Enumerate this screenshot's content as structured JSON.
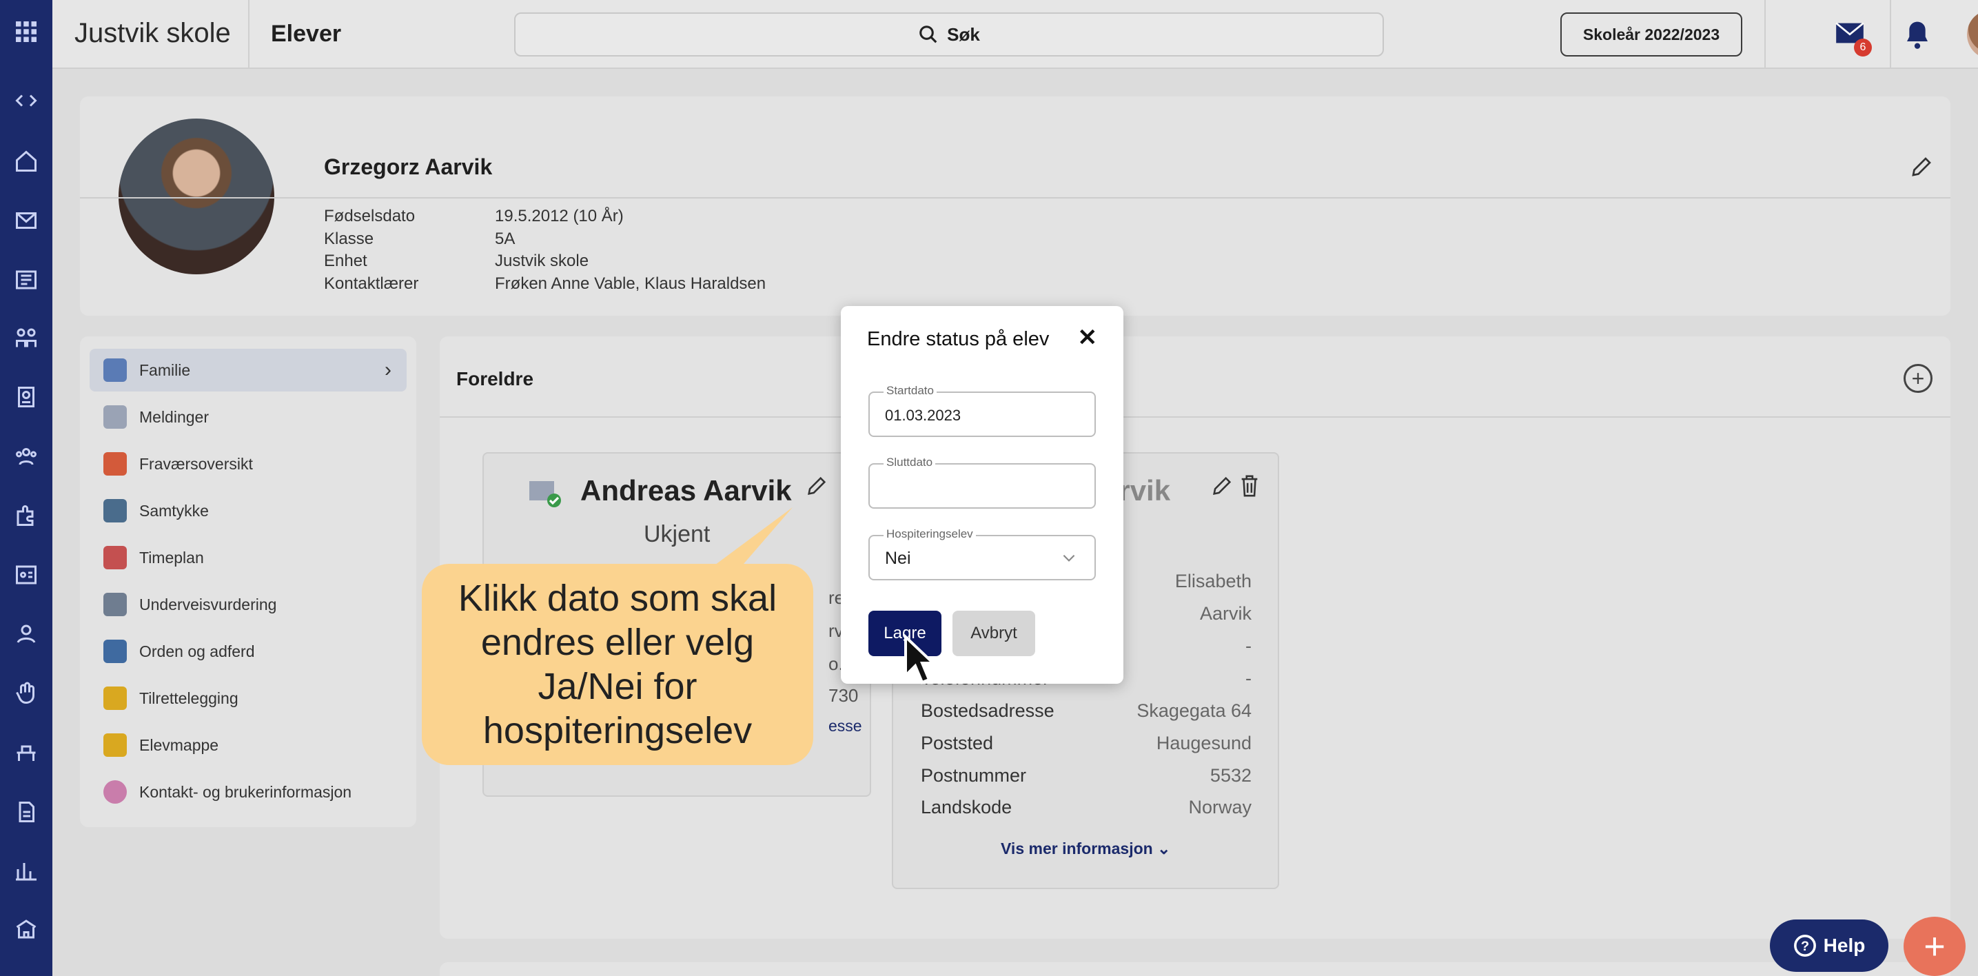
{
  "topbar": {
    "school_name": "Justvik skole",
    "section": "Elever",
    "search_label": "Søk",
    "school_year_button": "Skoleår 2022/2023",
    "mail_badge": "6"
  },
  "profile": {
    "name": "Grzegorz Aarvik",
    "fields": [
      {
        "label": "Fødselsdato",
        "value": "19.5.2012 (10 År)"
      },
      {
        "label": "Klasse",
        "value": "5A"
      },
      {
        "label": "Enhet",
        "value": "Justvik skole"
      },
      {
        "label": "Kontaktlærer",
        "value": "Frøken Anne Vable, Klaus Haraldsen"
      }
    ]
  },
  "nav": {
    "items": [
      {
        "label": "Familie",
        "color": "#5a7bb5"
      },
      {
        "label": "Meldinger",
        "color": "#9aa3b5"
      },
      {
        "label": "Fraværsoversikt",
        "color": "#d35a3a"
      },
      {
        "label": "Samtykke",
        "color": "#4a6c8c"
      },
      {
        "label": "Timeplan",
        "color": "#c45050"
      },
      {
        "label": "Underveisvurdering",
        "color": "#6f7d90"
      },
      {
        "label": "Orden og adferd",
        "color": "#3f6aa0"
      },
      {
        "label": "Tilrettelegging",
        "color": "#d9a820"
      },
      {
        "label": "Elevmappe",
        "color": "#d9a820"
      },
      {
        "label": "Kontakt- og brukerinformasjon",
        "color": "#c97dab"
      }
    ]
  },
  "main": {
    "title": "Foreldre",
    "parent1": {
      "name": "Andreas Aarvik",
      "status": "Ukjent",
      "partial": [
        "reas",
        "rvik",
        "o.no",
        "730",
        "esse"
      ]
    },
    "parent2": {
      "name_partial": "arvik",
      "rows": [
        {
          "label": "",
          "value": "Elisabeth"
        },
        {
          "label": "",
          "value": "Aarvik"
        },
        {
          "label": "",
          "value": "-"
        },
        {
          "label": "Telefonnummer",
          "value": "-"
        },
        {
          "label": "Bostedsadresse",
          "value": "Skagegata 64"
        },
        {
          "label": "Poststed",
          "value": "Haugesund"
        },
        {
          "label": "Postnummer",
          "value": "5532"
        },
        {
          "label": "Landskode",
          "value": "Norway"
        }
      ],
      "more_link": "Vis mer informasjon"
    }
  },
  "callout": {
    "text": "Klikk dato som skal endres eller velg Ja/Nei for hospiteringselev"
  },
  "modal": {
    "title": "Endre status på elev",
    "start_label": "Startdato",
    "start_value": "01.03.2023",
    "end_label": "Sluttdato",
    "end_value": "",
    "hosp_label": "Hospiteringselev",
    "hosp_value": "Nei",
    "save": "Lagre",
    "cancel": "Avbryt"
  },
  "help": {
    "label": "Help"
  },
  "colors": {
    "rail": "#1b2a6b",
    "save_button": "#0e1a63",
    "callout": "#fbd38f",
    "fab": "#e8735b"
  }
}
